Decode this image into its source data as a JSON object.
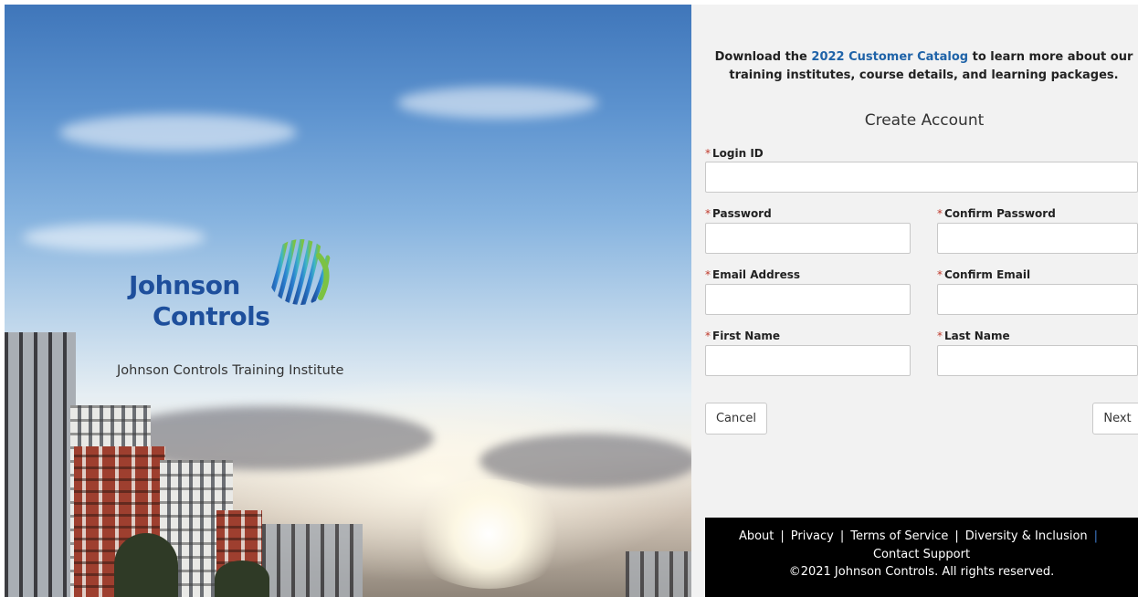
{
  "hero": {
    "logo_line1": "Johnson",
    "logo_line2": "Controls",
    "caption": "Johnson Controls Training Institute"
  },
  "catalog_note": {
    "prefix": "Download the ",
    "link_text": "2022 Customer Catalog",
    "suffix": " to learn more about our training institutes, course details, and learning packages."
  },
  "form": {
    "title": "Create Account",
    "required_marker": "*",
    "fields": {
      "login_id": {
        "label": "Login ID",
        "value": ""
      },
      "password": {
        "label": "Password",
        "value": ""
      },
      "confirm_password": {
        "label": "Confirm Password",
        "value": ""
      },
      "email": {
        "label": "Email Address",
        "value": ""
      },
      "confirm_email": {
        "label": "Confirm Email",
        "value": ""
      },
      "first_name": {
        "label": "First Name",
        "value": ""
      },
      "last_name": {
        "label": "Last Name",
        "value": ""
      }
    },
    "cancel_label": "Cancel",
    "next_label": "Next"
  },
  "footer": {
    "links": {
      "about": "About",
      "privacy": "Privacy",
      "terms": "Terms of Service",
      "diversity": "Diversity & Inclusion",
      "support": "Contact Support"
    },
    "separator": "|",
    "copyright": "©2021 Johnson Controls. All rights reserved."
  },
  "colors": {
    "brand_blue": "#1e4f9c",
    "link_blue": "#1f63a8",
    "required_red": "#c0392b",
    "footer_bg": "#000000"
  }
}
